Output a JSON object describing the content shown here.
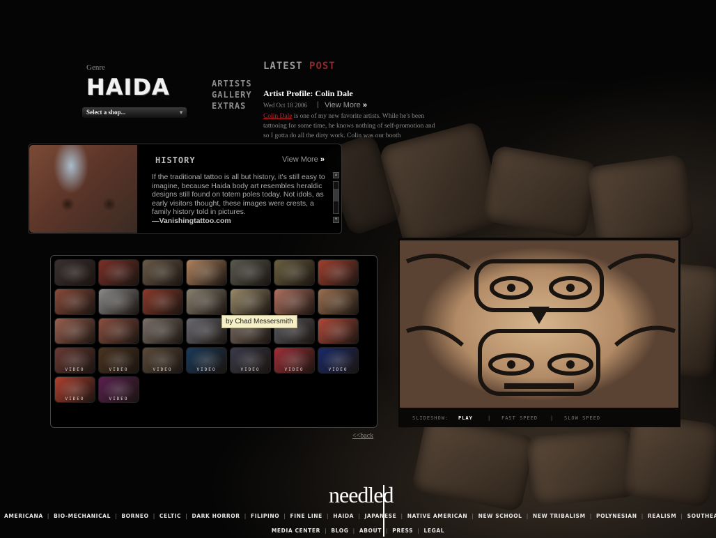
{
  "genre": {
    "label": "Genre",
    "name": "HAIDA"
  },
  "shop_select": {
    "label": "Select a shop..."
  },
  "side_nav": [
    "ARTISTS",
    "GALLERY",
    "EXTRAS"
  ],
  "latest_post": {
    "heading_1": "LATEST",
    "heading_2": "POST",
    "title": "Artist Profile: Colin Dale",
    "date": "Wed Oct 18 2006",
    "separator": "|",
    "view_more": "View More",
    "more_glyph": "»",
    "body_link": "Colin Dale",
    "body": " is one of my new favorite artists. While he's been tattooing for some time, he knows nothing of self-promotion and so I gotta do all the dirty work. Colin was our booth"
  },
  "history": {
    "title": "HISTORY",
    "view_more": "View More",
    "more_glyph": "»",
    "body": "If the traditional tattoo is all but history, it's still easy to imagine, because Haida body art resembles heraldic designs still found on totem poles today. Not idols, as early visitors thought, these images were crests, a family history told in pictures.",
    "signature": "—Vanishingtattoo.com"
  },
  "gallery": {
    "video_label": "VIDEO",
    "rows": [
      [
        {
          "color": "#3a3030",
          "video": false
        },
        {
          "color": "#7a3028",
          "video": false
        },
        {
          "color": "#6a5a48",
          "video": false
        },
        {
          "color": "#b08460",
          "video": false
        },
        {
          "color": "#5a5a50",
          "video": false
        },
        {
          "color": "#6a6040",
          "video": false
        },
        {
          "color": "#a04030",
          "video": false
        }
      ],
      [
        {
          "color": "#8a4a3a",
          "video": false
        },
        {
          "color": "#8a8a8a",
          "video": false
        },
        {
          "color": "#8a3a2a",
          "video": false
        },
        {
          "color": "#8a8070",
          "video": false
        },
        {
          "color": "#9a8a6a",
          "video": false
        },
        {
          "color": "#b07060",
          "video": false
        },
        {
          "color": "#9a7050",
          "video": false
        }
      ],
      [
        {
          "color": "#9a6050",
          "video": false
        },
        {
          "color": "#8a5040",
          "video": false
        },
        {
          "color": "#7a7068",
          "video": false
        },
        {
          "color": "#6a6a72",
          "video": false
        },
        {
          "color": "#7a6a60",
          "video": false
        },
        {
          "color": "#5a5a60",
          "video": false
        },
        {
          "color": "#b04a3a",
          "video": false
        }
      ],
      [
        {
          "color": "#6a3a34",
          "video": true
        },
        {
          "color": "#4a3420",
          "video": true
        },
        {
          "color": "#5a4a3a",
          "video": true
        },
        {
          "color": "#1a3a5a",
          "video": true
        },
        {
          "color": "#3a3a4a",
          "video": true
        },
        {
          "color": "#a03038",
          "video": true
        },
        {
          "color": "#1a2a6a",
          "video": true
        }
      ],
      [
        {
          "color": "#b04030",
          "video": true
        },
        {
          "color": "#5a2050",
          "video": true
        }
      ]
    ]
  },
  "tooltip": "by Chad Messersmith",
  "back_link": "<<back",
  "slideshow": {
    "label": "SLIDESHOW:",
    "play": "PLAY",
    "fast": "FAST SPEED",
    "slow": "SLOW SPEED",
    "sep": "|"
  },
  "logo": "needled",
  "footer": {
    "row1": [
      "AMERICANA",
      "BIO-MECHANICAL",
      "BORNEO",
      "CELTIC",
      "DARK HORROR",
      "FILIPINO",
      "FINE LINE",
      "HAIDA",
      "JAPANESE",
      "NATIVE AMERICAN",
      "NEW SCHOOL",
      "NEW TRIBALISM",
      "POLYNESIAN",
      "REALISM",
      "SOUTHEAST ASIAN"
    ],
    "row2": [
      "MEDIA CENTER",
      "BLOG",
      "ABOUT",
      "PRESS",
      "LEGAL"
    ],
    "sep": "|"
  }
}
